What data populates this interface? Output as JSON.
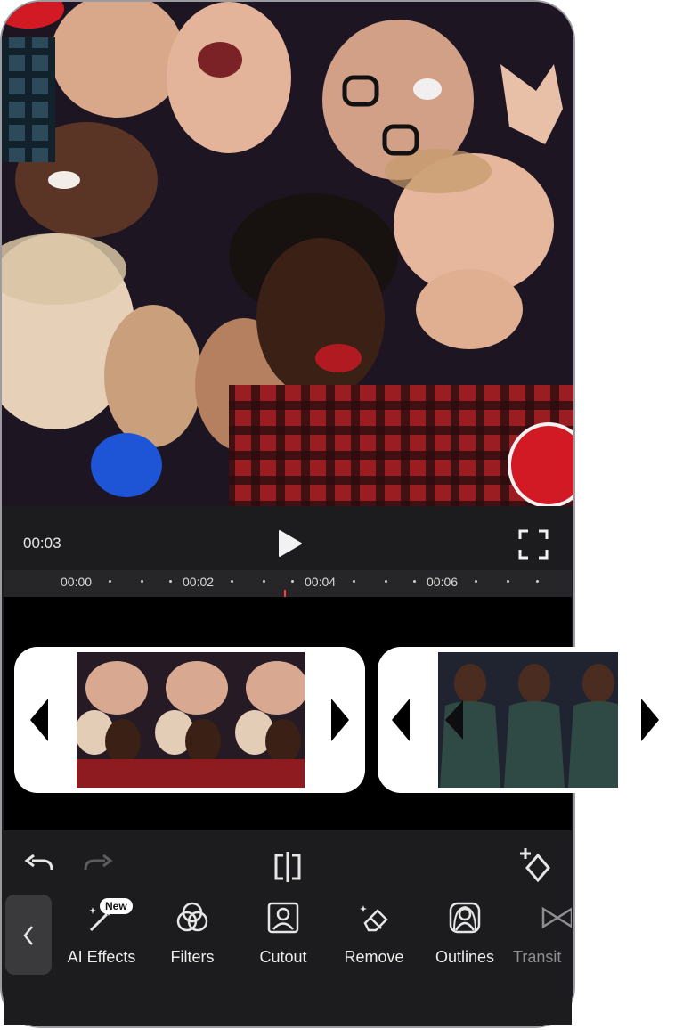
{
  "player": {
    "current_time": "00:03",
    "ruler_ticks": [
      "00:00",
      "00:02",
      "00:04",
      "00:06"
    ]
  },
  "tools": [
    {
      "label": "AI Effects",
      "icon": "magic-wand-icon",
      "badge": "New"
    },
    {
      "label": "Filters",
      "icon": "filters-icon"
    },
    {
      "label": "Cutout",
      "icon": "cutout-icon"
    },
    {
      "label": "Remove",
      "icon": "eraser-icon"
    },
    {
      "label": "Outlines",
      "icon": "outlines-icon"
    },
    {
      "label": "Transit",
      "icon": "transition-icon"
    }
  ],
  "colors": {
    "background": "#1c1c1e",
    "timeline": "#000000",
    "playhead": "#ff3b3b",
    "clip_frame": "#ffffff"
  }
}
